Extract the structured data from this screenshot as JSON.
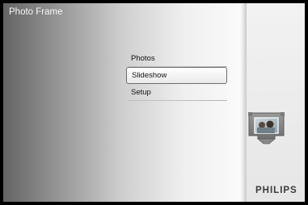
{
  "header": {
    "title": "Photo Frame"
  },
  "menu": {
    "items": [
      {
        "label": "Photos"
      },
      {
        "label": "Slideshow",
        "selected": true
      },
      {
        "label": "Setup"
      }
    ]
  },
  "sidebar": {
    "icon": "slideshow-frame-icon",
    "brand": "PHILIPS"
  },
  "colors": {
    "gradient_dark": "#646464",
    "gradient_light": "#fbfbfb",
    "selection_border": "#6e6e6e",
    "text": "#111111"
  }
}
